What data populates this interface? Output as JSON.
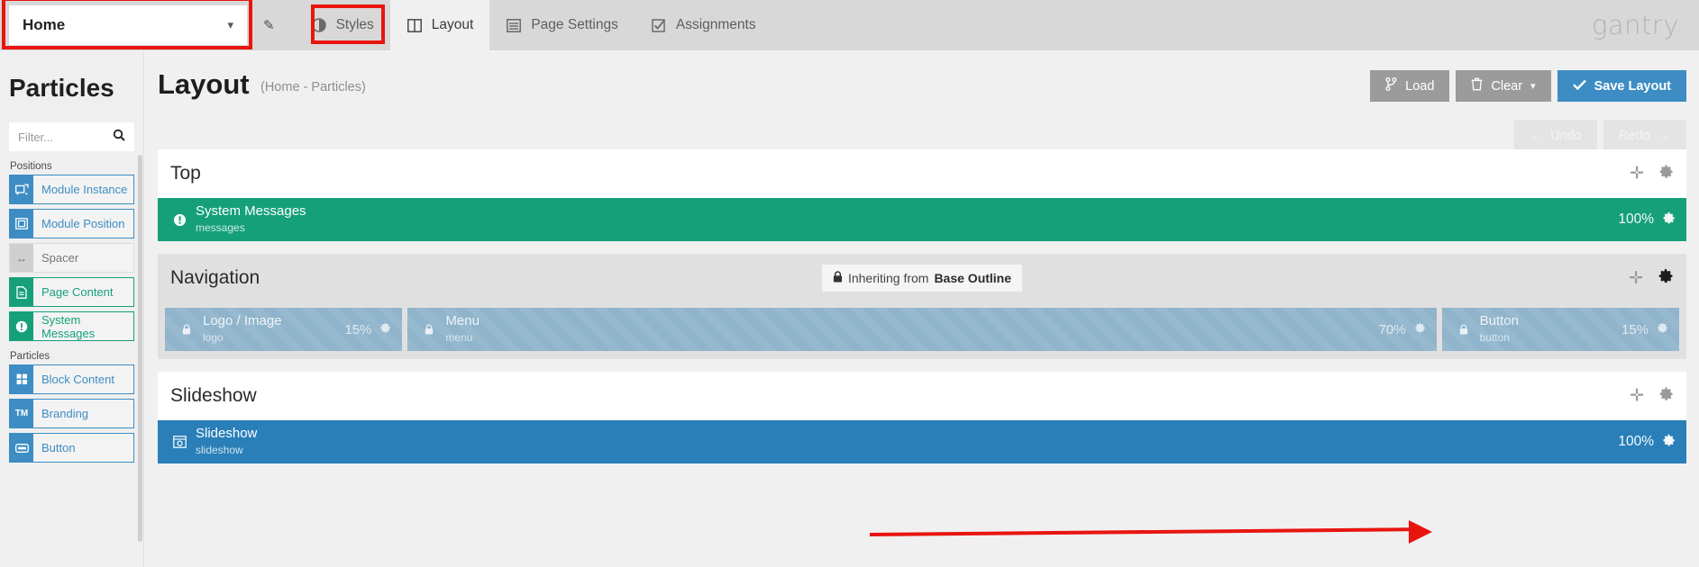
{
  "topbar": {
    "outline_select": {
      "value": "Home",
      "chevron": "chevron-down-icon"
    },
    "pen_icon": "pen-icon",
    "tabs": [
      {
        "label": "Styles",
        "icon": "styles-contrast-icon",
        "active": false
      },
      {
        "label": "Layout",
        "icon": "layout-columns-icon",
        "active": true
      },
      {
        "label": "Page Settings",
        "icon": "page-settings-icon",
        "active": false
      },
      {
        "label": "Assignments",
        "icon": "checkbox-icon",
        "active": false
      }
    ],
    "brand": "gantry"
  },
  "sidebar": {
    "title": "Particles",
    "filter": {
      "placeholder": "Filter...",
      "value": "",
      "icon": "search-icon"
    },
    "groups": [
      {
        "label": "Positions",
        "items": [
          {
            "label": "Module Instance",
            "icon": "module-instance-icon",
            "style": "blue"
          },
          {
            "label": "Module Position",
            "icon": "module-position-icon",
            "style": "blue"
          },
          {
            "label": "Spacer",
            "icon": "arrows-horizontal-icon",
            "style": "grey"
          },
          {
            "label": "Page Content",
            "icon": "document-icon",
            "style": "green"
          },
          {
            "label": "System Messages",
            "icon": "exclamation-icon",
            "style": "green"
          }
        ]
      },
      {
        "label": "Particles",
        "items": [
          {
            "label": "Block Content",
            "icon": "grid-blocks-icon",
            "style": "blue"
          },
          {
            "label": "Branding",
            "icon": "trademark-icon",
            "style": "blue"
          },
          {
            "label": "Button",
            "icon": "button-icon",
            "style": "blue"
          }
        ]
      }
    ]
  },
  "page": {
    "title": "Layout",
    "subtitle": "(Home - Particles)",
    "actions": [
      {
        "label": "Load",
        "icon": "branch-icon",
        "style": "grey"
      },
      {
        "label": "Clear",
        "icon": "trash-icon",
        "caret": "⌄",
        "style": "grey"
      },
      {
        "label": "Save Layout",
        "icon": "check-icon",
        "style": "blue"
      }
    ],
    "history": [
      {
        "label": "Undo",
        "icon": "arrow-left-icon"
      },
      {
        "label": "Redo",
        "icon": "arrow-right-icon"
      }
    ]
  },
  "sections": [
    {
      "name": "Top",
      "inheriting": false,
      "tools": [
        {
          "name": "add-icon",
          "glyph": "➕"
        },
        {
          "name": "gear-icon",
          "glyph": "⚙"
        }
      ],
      "blocks": [
        {
          "title": "System Messages",
          "subtitle": "messages",
          "icon": "exclamation-icon",
          "width": "100%",
          "style": "green",
          "locked": false,
          "flex": 100
        }
      ]
    },
    {
      "name": "Navigation",
      "inheriting": true,
      "inherit_text_prefix": "Inheriting from",
      "inherit_source": "Base Outline",
      "inherit_icon": "lock-icon",
      "tools": [
        {
          "name": "add-icon",
          "glyph": "➕"
        },
        {
          "name": "gear-icon",
          "glyph": "⚙"
        }
      ],
      "blocks": [
        {
          "title": "Logo / Image",
          "subtitle": "logo",
          "icon": "lock-icon",
          "width": "15%",
          "style": "locked",
          "locked": true,
          "flex": 15
        },
        {
          "title": "Menu",
          "subtitle": "menu",
          "icon": "lock-icon",
          "width": "70%",
          "style": "locked",
          "locked": true,
          "flex": 70
        },
        {
          "title": "Button",
          "subtitle": "button",
          "icon": "lock-icon",
          "width": "15%",
          "style": "locked",
          "locked": true,
          "flex": 15
        }
      ]
    },
    {
      "name": "Slideshow",
      "inheriting": false,
      "tools": [
        {
          "name": "add-icon",
          "glyph": "➕"
        },
        {
          "name": "gear-icon",
          "glyph": "⚙"
        }
      ],
      "blocks": [
        {
          "title": "Slideshow",
          "subtitle": "slideshow",
          "icon": "slideshow-icon",
          "width": "100%",
          "style": "blue",
          "locked": false,
          "flex": 100
        }
      ]
    }
  ],
  "annotations": {
    "red_color": "#e8150f",
    "arrow_target": "slideshow-block-gear-icon",
    "highlight_boxes": [
      "outline-select",
      "tab-layout"
    ]
  }
}
